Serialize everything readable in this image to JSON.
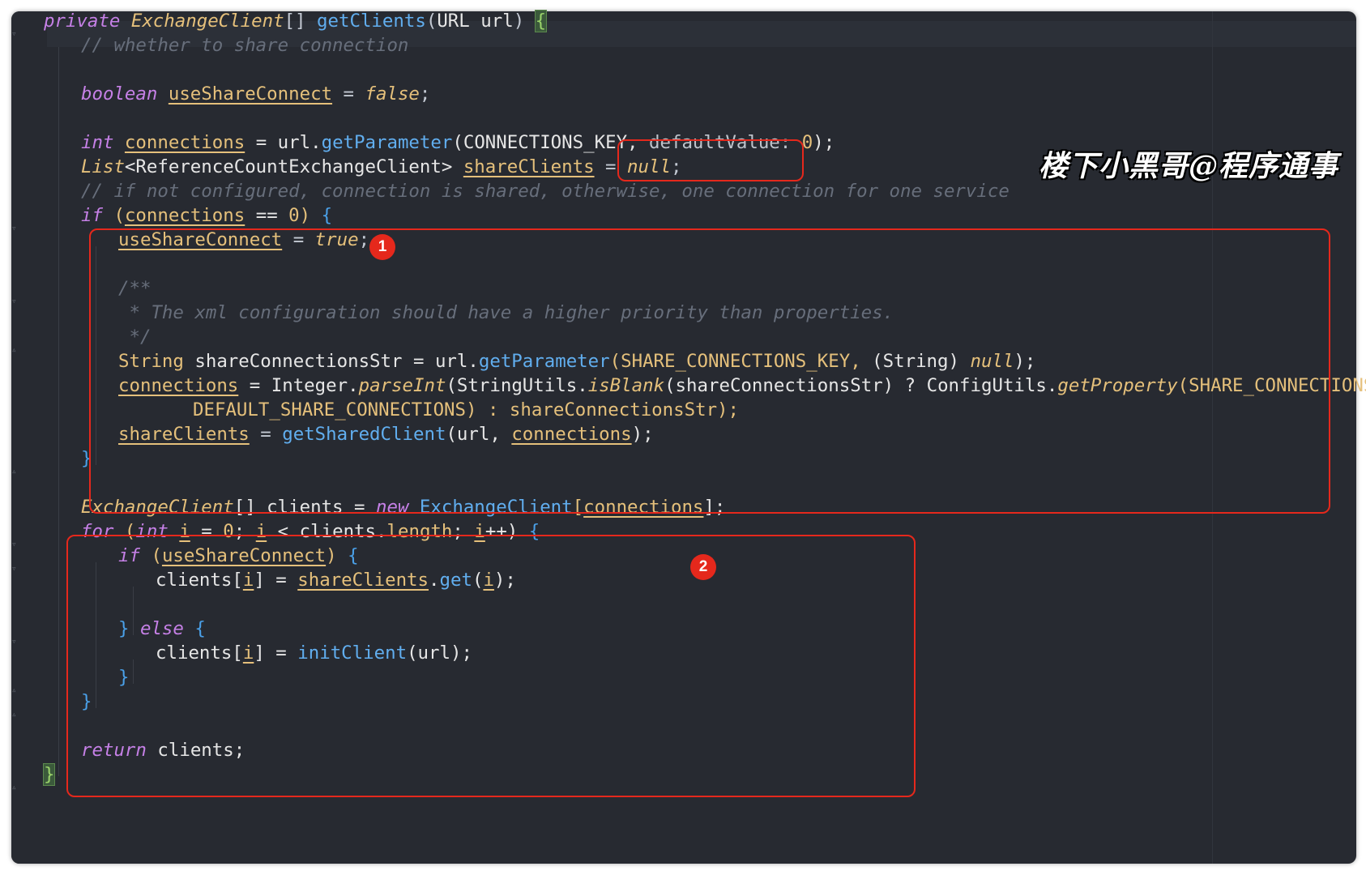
{
  "watermark": "楼下小黑哥@程序通事",
  "badges": {
    "one": "1",
    "two": "2"
  },
  "code": {
    "l1": {
      "private": "private ",
      "type": "ExchangeClient",
      "arr": "[] ",
      "fn": "getClients",
      "p1": "(",
      "t2": "URL",
      "v": " url",
      "p2": ")",
      "sp": " ",
      "brace": "{"
    },
    "l2": {
      "comment": "// whether to share connection"
    },
    "l4": {
      "kw": "boolean ",
      "var": "useShareConnect",
      "eq": " = ",
      "val": "false",
      "end": ";"
    },
    "l6": {
      "kw": "int ",
      "var": "connections",
      "eq": " = url.",
      "fn": "getParameter",
      "args": "(CONNECTIONS_KEY, ",
      "hint": "defaultValue: ",
      "num": "0",
      "end": ");"
    },
    "l7": {
      "type": "List",
      "gen": "<ReferenceCountExchangeClient> ",
      "var": "shareClients",
      "eq": " = ",
      "val": "null",
      "end": ";"
    },
    "l8": {
      "comment": "// if not configured, connection is shared, otherwise, one connection for one service"
    },
    "l9": {
      "kw": "if ",
      "p1": "(",
      "var": "connections",
      "op": " == ",
      "num": "0",
      "p2": ") ",
      "brace": "{"
    },
    "l10": {
      "var": "useShareConnect",
      "eq": " = ",
      "val": "true",
      "end": ";"
    },
    "l12": {
      "comment": "/**"
    },
    "l13": {
      "comment": " * The xml configuration should have a higher priority than properties."
    },
    "l14": {
      "comment": " */"
    },
    "l15": {
      "t": "String",
      "v": " shareConnectionsStr = url.",
      "fn": "getParameter",
      "a1": "(SHARE_CONNECTIONS_KEY, ",
      "cast": "(String) ",
      "val": "null",
      "end": ");"
    },
    "l16": {
      "var": "connections",
      "eq": " = Integer.",
      "fn": "parseInt",
      "a1": "(StringUtils.",
      "fn2": "isBlank",
      "a2": "(shareConnectionsStr) ? ConfigUtils.",
      "fn3": "getProperty",
      "a3": "(SHARE_CONNECTIONS_KEY,"
    },
    "l17": {
      "text": "DEFAULT_SHARE_CONNECTIONS) : shareConnectionsStr);"
    },
    "l18": {
      "var": "shareClients",
      "eq": " = ",
      "fn": "getSharedClient",
      "a1": "(url, ",
      "var2": "connections",
      "end": ");"
    },
    "l19": {
      "brace": "}"
    },
    "l21": {
      "type": "ExchangeClient",
      "a1": "[] clients = ",
      "kw": "new ",
      "fn": "ExchangeClient",
      "a2": "[",
      "var": "connections",
      "end": "];"
    },
    "l22": {
      "kw": "for ",
      "p1": "(",
      "kw2": "int ",
      "var": "i",
      "a1": " = ",
      "num": "0",
      "a2": "; ",
      "var2": "i",
      "a3": " < clients.",
      "fld": "length",
      "a4": "; ",
      "var3": "i",
      "a5": "++) ",
      "brace": "{"
    },
    "l23": {
      "kw": "if ",
      "p1": "(",
      "var": "useShareConnect",
      "p2": ") ",
      "brace": "{"
    },
    "l24": {
      "a1": "clients[",
      "var": "i",
      "a2": "] = ",
      "var2": "shareClients",
      "a3": ".",
      "fn": "get",
      "a4": "(",
      "var3": "i",
      "a5": ");"
    },
    "l26": {
      "brace": "} ",
      "kw": "else ",
      "brace2": "{"
    },
    "l27": {
      "a1": "clients[",
      "var": "i",
      "a2": "] = ",
      "fn": "initClient",
      "a3": "(url);"
    },
    "l28": {
      "brace": "}"
    },
    "l29": {
      "brace": "}"
    },
    "l31": {
      "kw": "return ",
      "a1": "clients;"
    },
    "l32": {
      "brace": "}"
    }
  }
}
